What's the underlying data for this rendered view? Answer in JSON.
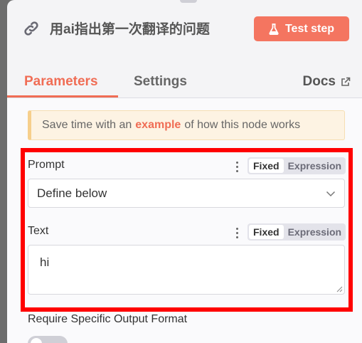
{
  "header": {
    "title": "用ai指出第一次翻译的问题",
    "test_button_label": "Test step"
  },
  "tabs": [
    {
      "label": "Parameters",
      "active": true
    },
    {
      "label": "Settings",
      "active": false
    }
  ],
  "docs_label": "Docs",
  "hint": {
    "prefix": "Save time with an",
    "link": "example",
    "suffix": "of how this node works"
  },
  "fields": {
    "prompt": {
      "label": "Prompt",
      "mode_fixed": "Fixed",
      "mode_expression": "Expression",
      "value": "Define below"
    },
    "text": {
      "label": "Text",
      "mode_fixed": "Fixed",
      "mode_expression": "Expression",
      "value": "hi"
    },
    "require_output_format": {
      "label": "Require Specific Output Format",
      "enabled": false
    }
  },
  "colors": {
    "accent": "#f06d55",
    "test_button": "#f47560",
    "highlight_border": "#ff0000"
  },
  "icons": {
    "title": "link-icon",
    "test": "flask-icon",
    "docs": "external-link-icon",
    "select": "chevron-down-icon",
    "options": "kebab-menu-icon"
  }
}
